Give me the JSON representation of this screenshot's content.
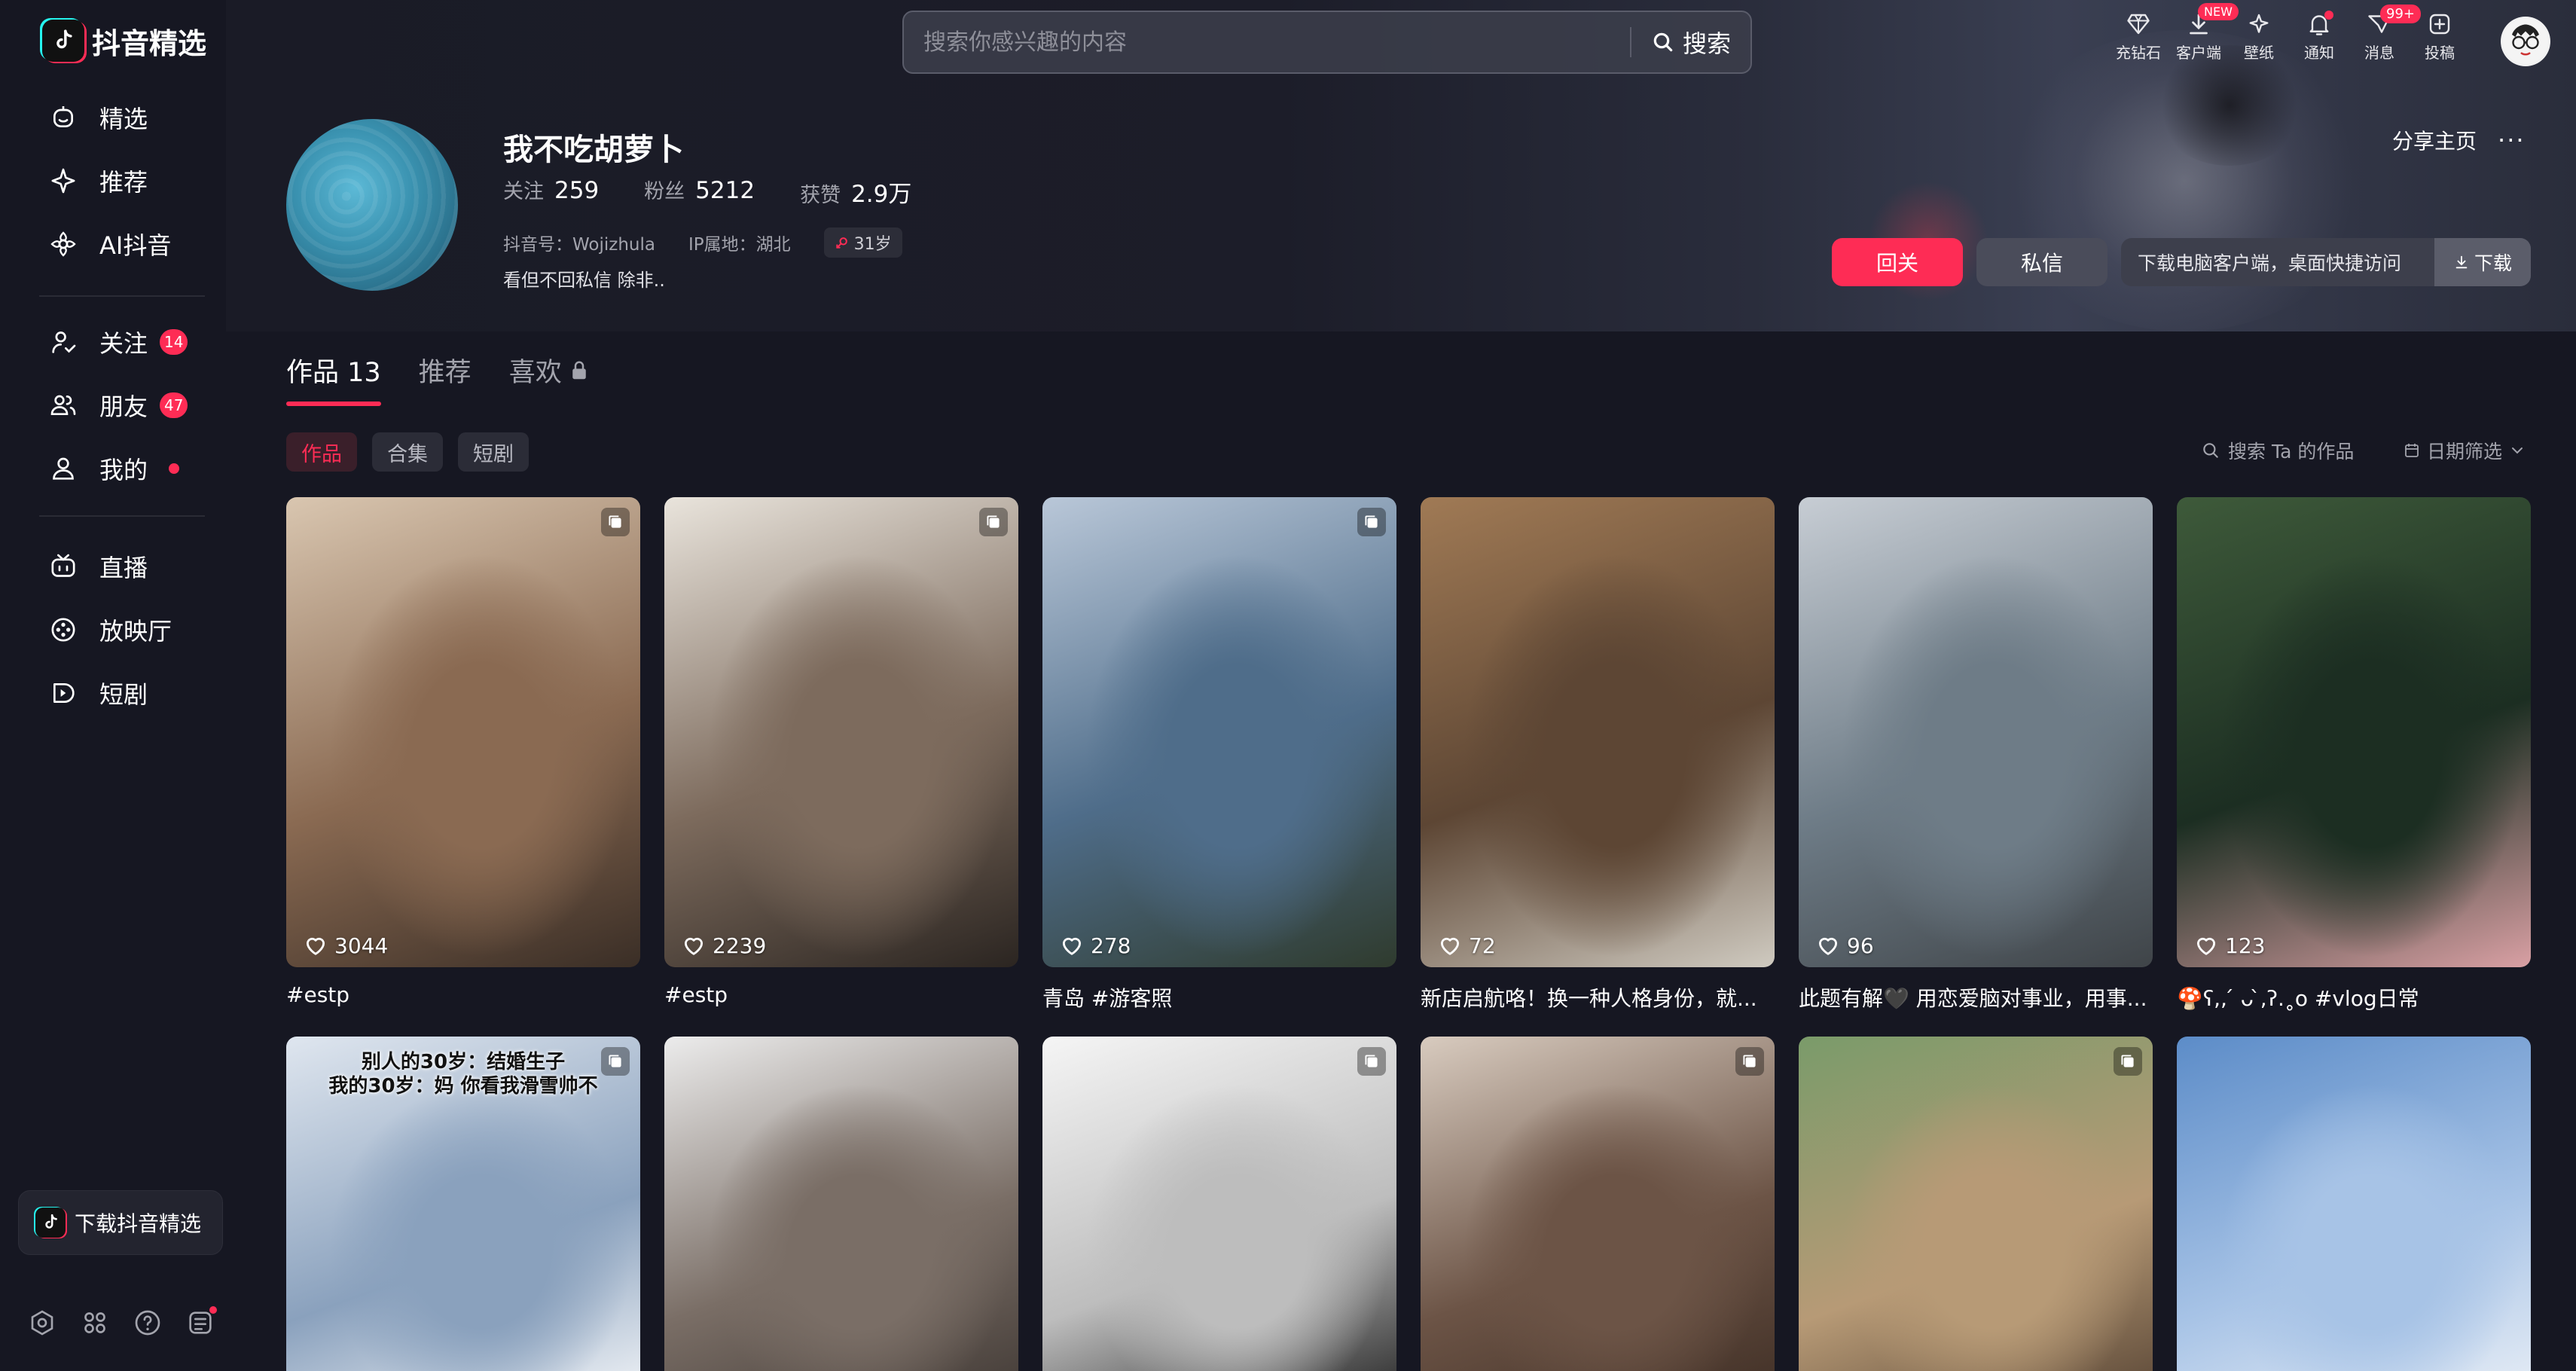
{
  "sidebar": {
    "logo_text": "抖音精选",
    "group1": [
      {
        "label": "精选",
        "icon": "featured-icon"
      },
      {
        "label": "推荐",
        "icon": "sparkle-icon"
      },
      {
        "label": "AI抖音",
        "icon": "ai-icon"
      }
    ],
    "group2": [
      {
        "label": "关注",
        "icon": "follow-icon",
        "badge": "14"
      },
      {
        "label": "朋友",
        "icon": "friends-icon",
        "badge": "47"
      },
      {
        "label": "我的",
        "icon": "me-icon",
        "dot": true
      }
    ],
    "group3": [
      {
        "label": "直播",
        "icon": "live-icon"
      },
      {
        "label": "放映厅",
        "icon": "cinema-icon"
      },
      {
        "label": "短剧",
        "icon": "drama-icon"
      }
    ],
    "download_label": "下载抖音精选"
  },
  "search": {
    "placeholder": "搜索你感兴趣的内容",
    "button_label": "搜索"
  },
  "top_actions": [
    {
      "label": "充钻石",
      "icon": "diamond-icon"
    },
    {
      "label": "客户端",
      "icon": "download-icon",
      "tag": "NEW"
    },
    {
      "label": "壁纸",
      "icon": "wallpaper-icon"
    },
    {
      "label": "通知",
      "icon": "bell-icon",
      "dot": true
    },
    {
      "label": "消息",
      "icon": "message-icon",
      "tag": "99+"
    },
    {
      "label": "投稿",
      "icon": "upload-icon"
    }
  ],
  "profile": {
    "name": "我不吃胡萝卜",
    "stats": [
      {
        "key": "关注",
        "value": "259"
      },
      {
        "key": "粉丝",
        "value": "5212"
      },
      {
        "key": "获赞",
        "value": "2.9万"
      }
    ],
    "douyin_id": "抖音号：Wojizhula",
    "ip": "IP属地：湖北",
    "age": "31岁",
    "bio": "看但不回私信 除非..",
    "share_label": "分享主页",
    "more_label": "···",
    "follow_back_label": "回关",
    "message_label": "私信",
    "download_client_text": "下载电脑客户端，桌面快捷访问",
    "download_btn_label": "下载"
  },
  "tabs": [
    {
      "label": "作品 13",
      "active": true
    },
    {
      "label": "推荐",
      "active": false
    },
    {
      "label": "喜欢",
      "active": false,
      "locked": true
    }
  ],
  "filter_chips": [
    {
      "label": "作品",
      "active": true
    },
    {
      "label": "合集",
      "active": false
    },
    {
      "label": "短剧",
      "active": false
    }
  ],
  "search_works_label": "搜索 Ta 的作品",
  "date_filter_label": "日期筛选",
  "videos": [
    {
      "likes": "3044",
      "caption": "#estp",
      "multi": true,
      "colors": [
        "#d9c6b0",
        "#8a6a52",
        "#3a2e26"
      ]
    },
    {
      "likes": "2239",
      "caption": "#estp",
      "multi": true,
      "colors": [
        "#e9e4dc",
        "#7d6b5d",
        "#2b2521"
      ]
    },
    {
      "likes": "278",
      "caption": "青岛 #游客照",
      "multi": true,
      "colors": [
        "#b9c7d8",
        "#4f6d8a",
        "#2f3b2e"
      ]
    },
    {
      "likes": "72",
      "caption": "新店启航咯！换一种人格身份，就...",
      "multi": false,
      "colors": [
        "#a07a55",
        "#5d4634",
        "#cfcac0"
      ]
    },
    {
      "likes": "96",
      "caption": "此题有解🖤 用恋爱脑对事业，用事...",
      "multi": false,
      "colors": [
        "#c7cdd4",
        "#6e7c87",
        "#3f4448"
      ]
    },
    {
      "likes": "123",
      "caption": "🍄ʕ,, ́ ᴗ ̀,ʔ.˳o #vlog日常",
      "multi": false,
      "colors": [
        "#3e5a3a",
        "#1c2e22",
        "#d9a0a4"
      ]
    },
    {
      "likes": "",
      "caption": "",
      "multi": true,
      "overlay": "别人的30岁：结婚生子\n我的30岁：妈 你看我滑雪帅不",
      "colors": [
        "#dfe6ef",
        "#8aa1bd",
        "#ffffff"
      ]
    },
    {
      "likes": "",
      "caption": "",
      "multi": false,
      "colors": [
        "#ececec",
        "#7a6e66",
        "#3b3430"
      ]
    },
    {
      "likes": "",
      "caption": "",
      "multi": true,
      "colors": [
        "#f5f5f5",
        "#bdbdbd",
        "#161616"
      ]
    },
    {
      "likes": "",
      "caption": "",
      "multi": true,
      "colors": [
        "#d8cbbf",
        "#6c5446",
        "#3b2b22"
      ]
    },
    {
      "likes": "",
      "caption": "",
      "multi": true,
      "colors": [
        "#7a9b6a",
        "#b79a76",
        "#4e3c2e"
      ]
    },
    {
      "likes": "",
      "caption": "",
      "multi": false,
      "colors": [
        "#5c8cc8",
        "#a7c3e6",
        "#f1f4f8"
      ]
    }
  ]
}
